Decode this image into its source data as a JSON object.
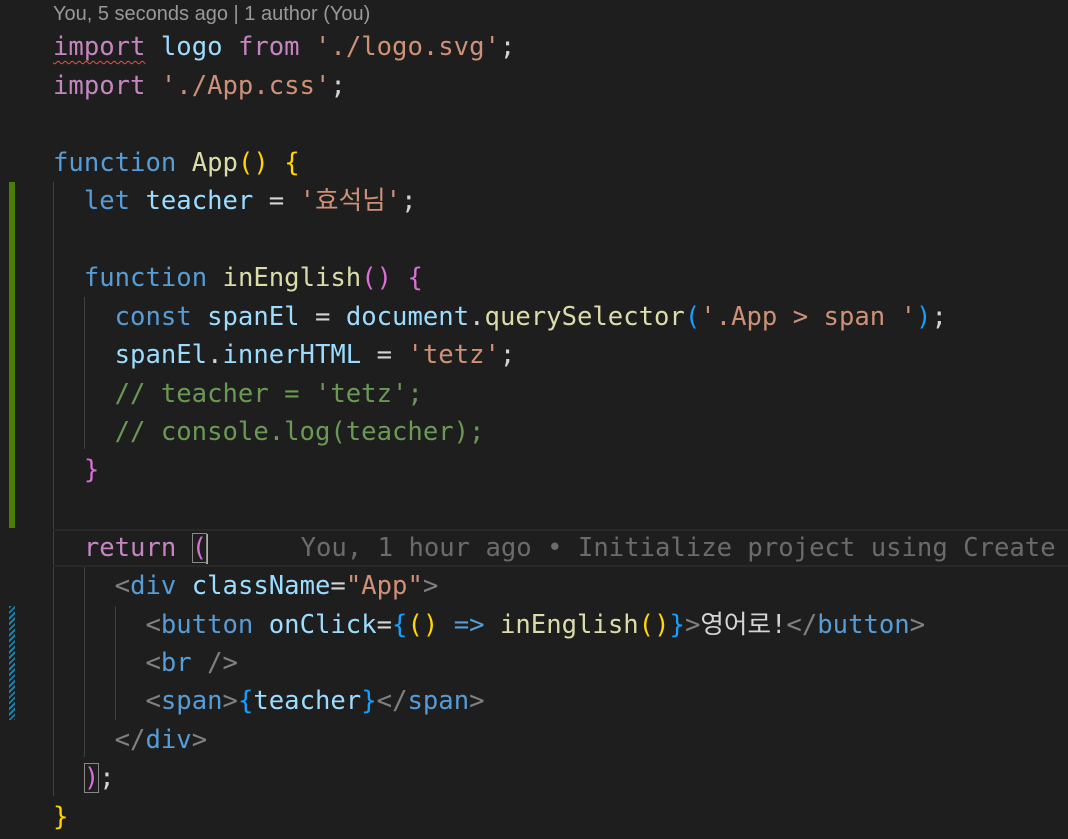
{
  "codelens": "You, 5 seconds ago | 1 author (You)",
  "inline_blame": "You, 1 hour ago • Initialize project using Create",
  "gutter": {
    "added_color": "#487e02",
    "modified_color": "#1b81a8"
  },
  "code": {
    "l1": {
      "kw_import": "import",
      "id_logo": "logo",
      "kw_from": "from",
      "str_path": "'./logo.svg'",
      "semi": ";"
    },
    "l2": {
      "kw_import": "import",
      "str_path": "'./App.css'",
      "semi": ";"
    },
    "l4": {
      "kw_function": "function",
      "fn_name": "App",
      "paren_open": "(",
      "paren_close": ")",
      "brace": "{"
    },
    "l5": {
      "kw_let": "let",
      "var": "teacher",
      "op": "=",
      "str": "'효석님'",
      "semi": ";"
    },
    "l7": {
      "kw_function": "function",
      "fn_name": "inEnglish",
      "paren_open": "(",
      "paren_close": ")",
      "brace": "{"
    },
    "l8": {
      "kw_const": "const",
      "var": "spanEl",
      "op": "=",
      "obj": "document",
      "dot": ".",
      "method": "querySelector",
      "paren_open": "(",
      "str": "'.App > span '",
      "paren_close": ")",
      "semi": ";"
    },
    "l9": {
      "obj": "spanEl",
      "dot": ".",
      "prop": "innerHTML",
      "op": "=",
      "str": "'tetz'",
      "semi": ";"
    },
    "l10": {
      "comment": "// teacher = 'tetz';"
    },
    "l11": {
      "comment": "// console.log(teacher);"
    },
    "l12": {
      "brace": "}"
    },
    "l14": {
      "kw_return": "return",
      "paren": "("
    },
    "l15": {
      "lt": "<",
      "tag": "div",
      "attr": "className",
      "eq": "=",
      "val": "\"App\"",
      "gt": ">"
    },
    "l16": {
      "lt": "<",
      "tag": "button",
      "attr": "onClick",
      "eq": "=",
      "brace_open": "{",
      "arrow_paren_open": "(",
      "arrow_paren_close": ")",
      "arrow": "=>",
      "fn_call": "inEnglish",
      "call_paren_open": "(",
      "call_paren_close": ")",
      "brace_close": "}",
      "gt": ">",
      "text": "영어로!",
      "close_lt": "</",
      "close_tag": "button",
      "close_gt": ">"
    },
    "l17": {
      "lt": "<",
      "tag": "br",
      "self_close": "/>"
    },
    "l18": {
      "lt": "<",
      "tag": "span",
      "gt": ">",
      "brace_open": "{",
      "expr": "teacher",
      "brace_close": "}",
      "close_lt": "</",
      "close_tag": "span",
      "close_gt": ">"
    },
    "l19": {
      "close_lt": "</",
      "tag": "div",
      "gt": ">"
    },
    "l20": {
      "paren": ")",
      "semi": ";"
    },
    "l21": {
      "brace": "}"
    }
  }
}
